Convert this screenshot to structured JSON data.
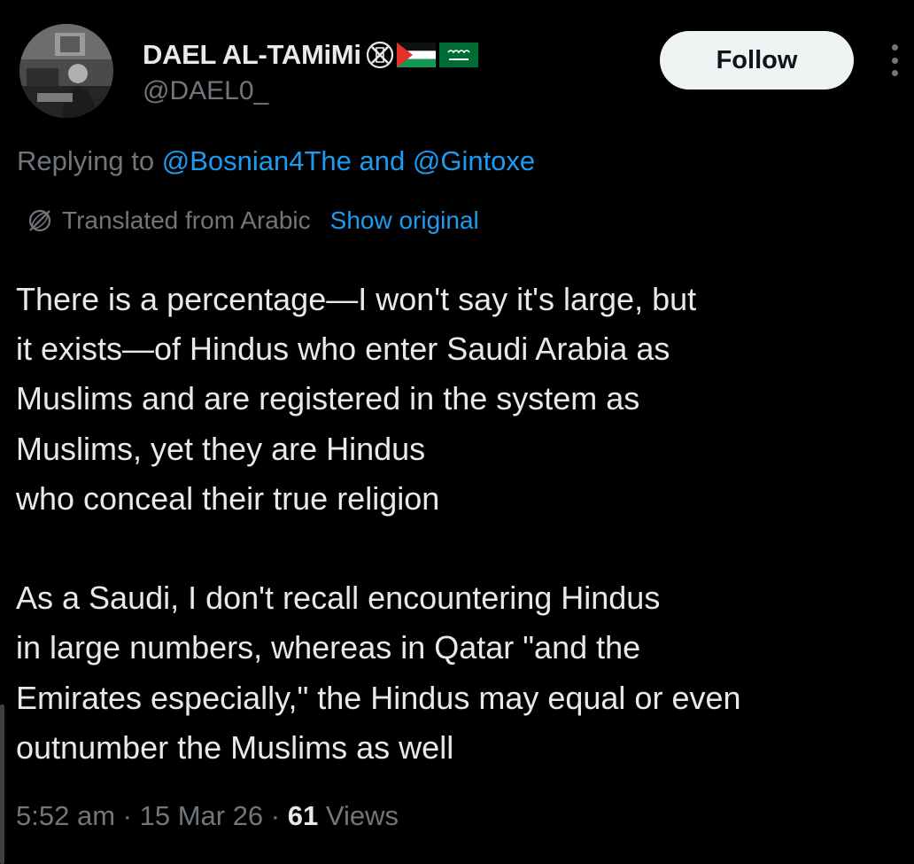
{
  "tweet": {
    "author": {
      "display_name": "DAEL AL-TAMiMi",
      "name_emoji": [
        "no-sign-x-icon",
        "palestine-flag-icon",
        "saudi-flag-icon"
      ],
      "handle": "@DAEL0_"
    },
    "follow_label": "Follow",
    "more_icon": "more-vertical-icon",
    "reply": {
      "prefix": "Replying to",
      "mention_1": "@Bosnian4The",
      "joiner": "and",
      "mention_2": "@Gintoxe"
    },
    "translation": {
      "icon": "translate-globe-icon",
      "label": "Translated from Arabic",
      "show_original": "Show original"
    },
    "text_lines": [
      "There is a percentage—I won't say it's large, but",
      "it exists—of Hindus who enter Saudi Arabia as",
      "Muslims and are registered in the system as",
      "Muslims, yet they are Hindus",
      "who conceal their true religion",
      "",
      "As a Saudi, I don't recall encountering Hindus",
      "in large numbers, whereas in Qatar \"and the",
      "Emirates especially,\" the Hindus may equal or even",
      "outnumber the Muslims as well"
    ],
    "meta": {
      "time": "5:52 am",
      "date": "15 Mar 26",
      "views_count": "61",
      "views_label": "Views"
    }
  },
  "colors": {
    "background": "#000000",
    "primary_text": "#e7e9ea",
    "secondary_text": "#71767b",
    "link": "#1d9bf0",
    "follow_bg": "#eff3f4",
    "follow_text": "#0f1419"
  }
}
